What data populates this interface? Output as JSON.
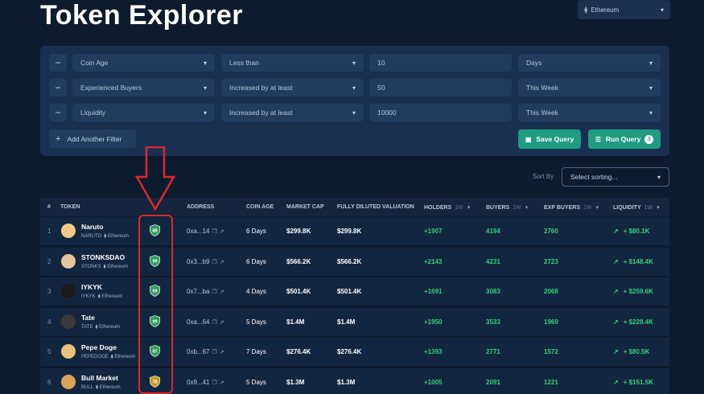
{
  "page": {
    "title": "Token Explorer"
  },
  "network": {
    "label": "Ethereum",
    "icon": "ethereum-icon"
  },
  "filters": [
    {
      "field": "Coin Age",
      "operator": "Less than",
      "value": "10",
      "unit": "Days"
    },
    {
      "field": "Experienced Buyers",
      "operator": "Increased by at least",
      "value": "50",
      "unit": "This Week"
    },
    {
      "field": "Liquidity",
      "operator": "Increased by at least",
      "value": "10000",
      "unit": "This Week"
    }
  ],
  "actions": {
    "add_filter": "Add Another Filter",
    "save_query": "Save Query",
    "run_query": "Run Query",
    "run_query_count": "3"
  },
  "sort": {
    "label": "Sort By",
    "placeholder": "Select sorting..."
  },
  "table": {
    "headers": {
      "index": "#",
      "token": "TOKEN",
      "address": "ADDRESS",
      "coin_age": "COIN AGE",
      "market_cap": "MARKET CAP",
      "fdv": "FULLY DILUTED VALUATION",
      "holders": "HOLDERS",
      "holders_period": "1W",
      "buyers": "BUYERS",
      "buyers_period": "1W",
      "exp_buyers": "EXP BUYERS",
      "exp_buyers_period": "1W",
      "liquidity": "LIQUIDITY",
      "liquidity_period": "1W"
    },
    "rows": [
      {
        "index": "1",
        "name": "Naruto",
        "symbol": "NARUTO",
        "chain": "Ethereum",
        "score": "88",
        "score_color": "#2e9e5b",
        "address": "0xa...14",
        "coin_age": "6 Days",
        "market_cap": "$299.8K",
        "fdv": "$299.8K",
        "holders": "+1907",
        "buyers": "4194",
        "exp_buyers": "2760",
        "liquidity": "+ $80.1K",
        "avatar_color": "#f1c98a"
      },
      {
        "index": "2",
        "name": "STONKSDAO",
        "symbol": "STONKS",
        "chain": "Ethereum",
        "score": "99",
        "score_color": "#2e9e5b",
        "address": "0x3...b9",
        "coin_age": "6 Days",
        "market_cap": "$566.2K",
        "fdv": "$566.2K",
        "holders": "+2143",
        "buyers": "4231",
        "exp_buyers": "2723",
        "liquidity": "+ $148.4K",
        "avatar_color": "#e7c49c"
      },
      {
        "index": "3",
        "name": "IYKYK",
        "symbol": "IYKYK",
        "chain": "Ethereum",
        "score": "99",
        "score_color": "#2e9e5b",
        "address": "0x7...ba",
        "coin_age": "4 Days",
        "market_cap": "$501.4K",
        "fdv": "$501.4K",
        "holders": "+1691",
        "buyers": "3083",
        "exp_buyers": "2068",
        "liquidity": "+ $259.6K",
        "avatar_color": "#1a1a1a"
      },
      {
        "index": "4",
        "name": "Tate",
        "symbol": "TATE",
        "chain": "Ethereum",
        "score": "99",
        "score_color": "#2e9e5b",
        "address": "0xa...64",
        "coin_age": "5 Days",
        "market_cap": "$1.4M",
        "fdv": "$1.4M",
        "holders": "+1950",
        "buyers": "3533",
        "exp_buyers": "1969",
        "liquidity": "+ $228.4K",
        "avatar_color": "#3a3a3a"
      },
      {
        "index": "5",
        "name": "Pepe Doge",
        "symbol": "PEPEDOGE",
        "chain": "Ethereum",
        "score": "87",
        "score_color": "#2e9e5b",
        "address": "0xb...67",
        "coin_age": "7 Days",
        "market_cap": "$276.4K",
        "fdv": "$276.4K",
        "holders": "+1393",
        "buyers": "2771",
        "exp_buyers": "1572",
        "liquidity": "+ $80.5K",
        "avatar_color": "#e8c27a"
      },
      {
        "index": "6",
        "name": "Bull Market",
        "symbol": "BULL",
        "chain": "Ethereum",
        "score": "78",
        "score_color": "#c99a1e",
        "address": "0x9...41",
        "coin_age": "5 Days",
        "market_cap": "$1.3M",
        "fdv": "$1.3M",
        "holders": "+1005",
        "buyers": "2091",
        "exp_buyers": "1221",
        "liquidity": "+ $151.5K",
        "avatar_color": "#d9a35a"
      }
    ]
  },
  "colors": {
    "background": "#0d1b2e",
    "accent": "#1f9c82",
    "positive": "#36d07a",
    "annotation": "#e0262d"
  }
}
